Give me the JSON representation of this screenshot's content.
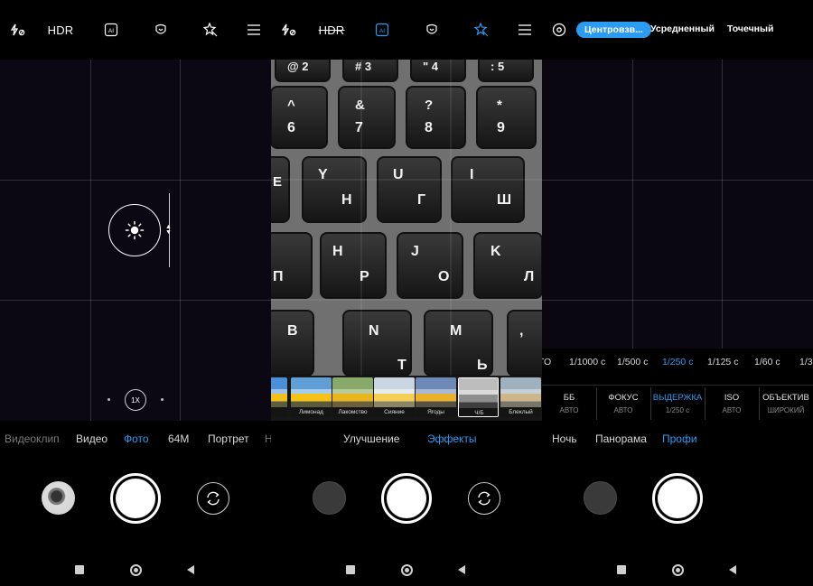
{
  "colors": {
    "accent": "#2b9cf2",
    "background": "#000000"
  },
  "panel1": {
    "topbar": {
      "icons": [
        "flash-off-icon",
        "hdr",
        "ai-icon",
        "beauty-icon",
        "magic-icon",
        "menu-icon"
      ],
      "hdr_label": "HDR"
    },
    "zoom_label": "1X",
    "modes": [
      "Видеоклип",
      "Видео",
      "Фото",
      "64M",
      "Портрет"
    ],
    "active_mode": "Фото"
  },
  "panel2": {
    "topbar": {
      "hdr_label": "HDR",
      "active_icons": [
        "ai-icon",
        "magic-icon"
      ]
    },
    "filters": [
      "й",
      "Лимонад",
      "Лакомство",
      "Сияние",
      "Ягоды",
      "Ч/Б",
      "Блеклый"
    ],
    "selected_filter": "Ч/Б",
    "keys": {
      "row1": [
        "@ 2",
        "# 3",
        "\" 4",
        ": 5"
      ],
      "row1b": [
        "^ 6",
        "& 7",
        "? 8",
        "* 9"
      ],
      "row2": [
        "Y Н",
        "U Г",
        "I Ш"
      ],
      "row3": [
        "H П",
        "J Р",
        "K О",
        "Л"
      ],
      "row4": [
        "B И",
        "N Т",
        "M Ь"
      ],
      "row2_left_fragment": "Е",
      "row2_fragment": "Ш",
      "row3_fragment": "Л"
    },
    "modes": [
      "Улучшение",
      "Эффекты"
    ],
    "active_mode": "Эффекты"
  },
  "panel3": {
    "metering": [
      "Центровзв...",
      "Усредненный",
      "Точечный"
    ],
    "active_metering": "Центровзв...",
    "shutter_speeds": [
      "ТО",
      "1/1000 с",
      "1/500 с",
      "1/250 с",
      "1/125 с",
      "1/60 с",
      "1/3"
    ],
    "active_speed": "1/250 с",
    "params": [
      {
        "label": "ББ",
        "value": "АВТО"
      },
      {
        "label": "ФОКУС",
        "value": "АВТО"
      },
      {
        "label": "ВЫДЕРЖКА",
        "value": "1/250 с"
      },
      {
        "label": "ISO",
        "value": "АВТО"
      },
      {
        "label": "ОБЪЕКТИВ",
        "value": "ШИРОКИЙ"
      }
    ],
    "active_param": "ВЫДЕРЖКА",
    "modes": [
      "Ночь",
      "Панорама",
      "Профи"
    ],
    "active_mode": "Профи"
  }
}
